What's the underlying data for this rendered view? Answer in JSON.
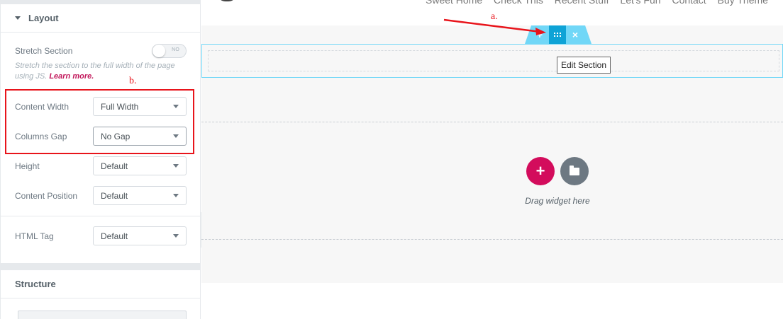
{
  "nav": {
    "items": [
      "Sweet Home",
      "Check This",
      "Recent Stuff",
      "Let's Fun",
      "Contact",
      "Buy Theme"
    ]
  },
  "layout_section": {
    "title": "Layout",
    "stretch": {
      "label": "Stretch Section",
      "toggle_text": "NO"
    },
    "description": "Stretch the section to the full width of the page using JS.",
    "learn_more": "Learn more.",
    "content_width": {
      "label": "Content Width",
      "value": "Full Width"
    },
    "columns_gap": {
      "label": "Columns Gap",
      "value": "No Gap"
    },
    "height": {
      "label": "Height",
      "value": "Default"
    },
    "content_position": {
      "label": "Content Position",
      "value": "Default"
    },
    "html_tag": {
      "label": "HTML Tag",
      "value": "Default"
    }
  },
  "structure_section": {
    "title": "Structure"
  },
  "annotations": {
    "a": "a.",
    "b": "b."
  },
  "canvas": {
    "handle": {
      "add": "+",
      "delete": "×"
    },
    "tooltip": "Edit Section",
    "add_button": "+",
    "drag_text": "Drag widget here"
  },
  "colors": {
    "accent_pink": "#d30c5c",
    "handle_blue": "#71d7f7",
    "handle_blue_dark": "#0ea3d6",
    "annotation_red": "#e8141b"
  }
}
